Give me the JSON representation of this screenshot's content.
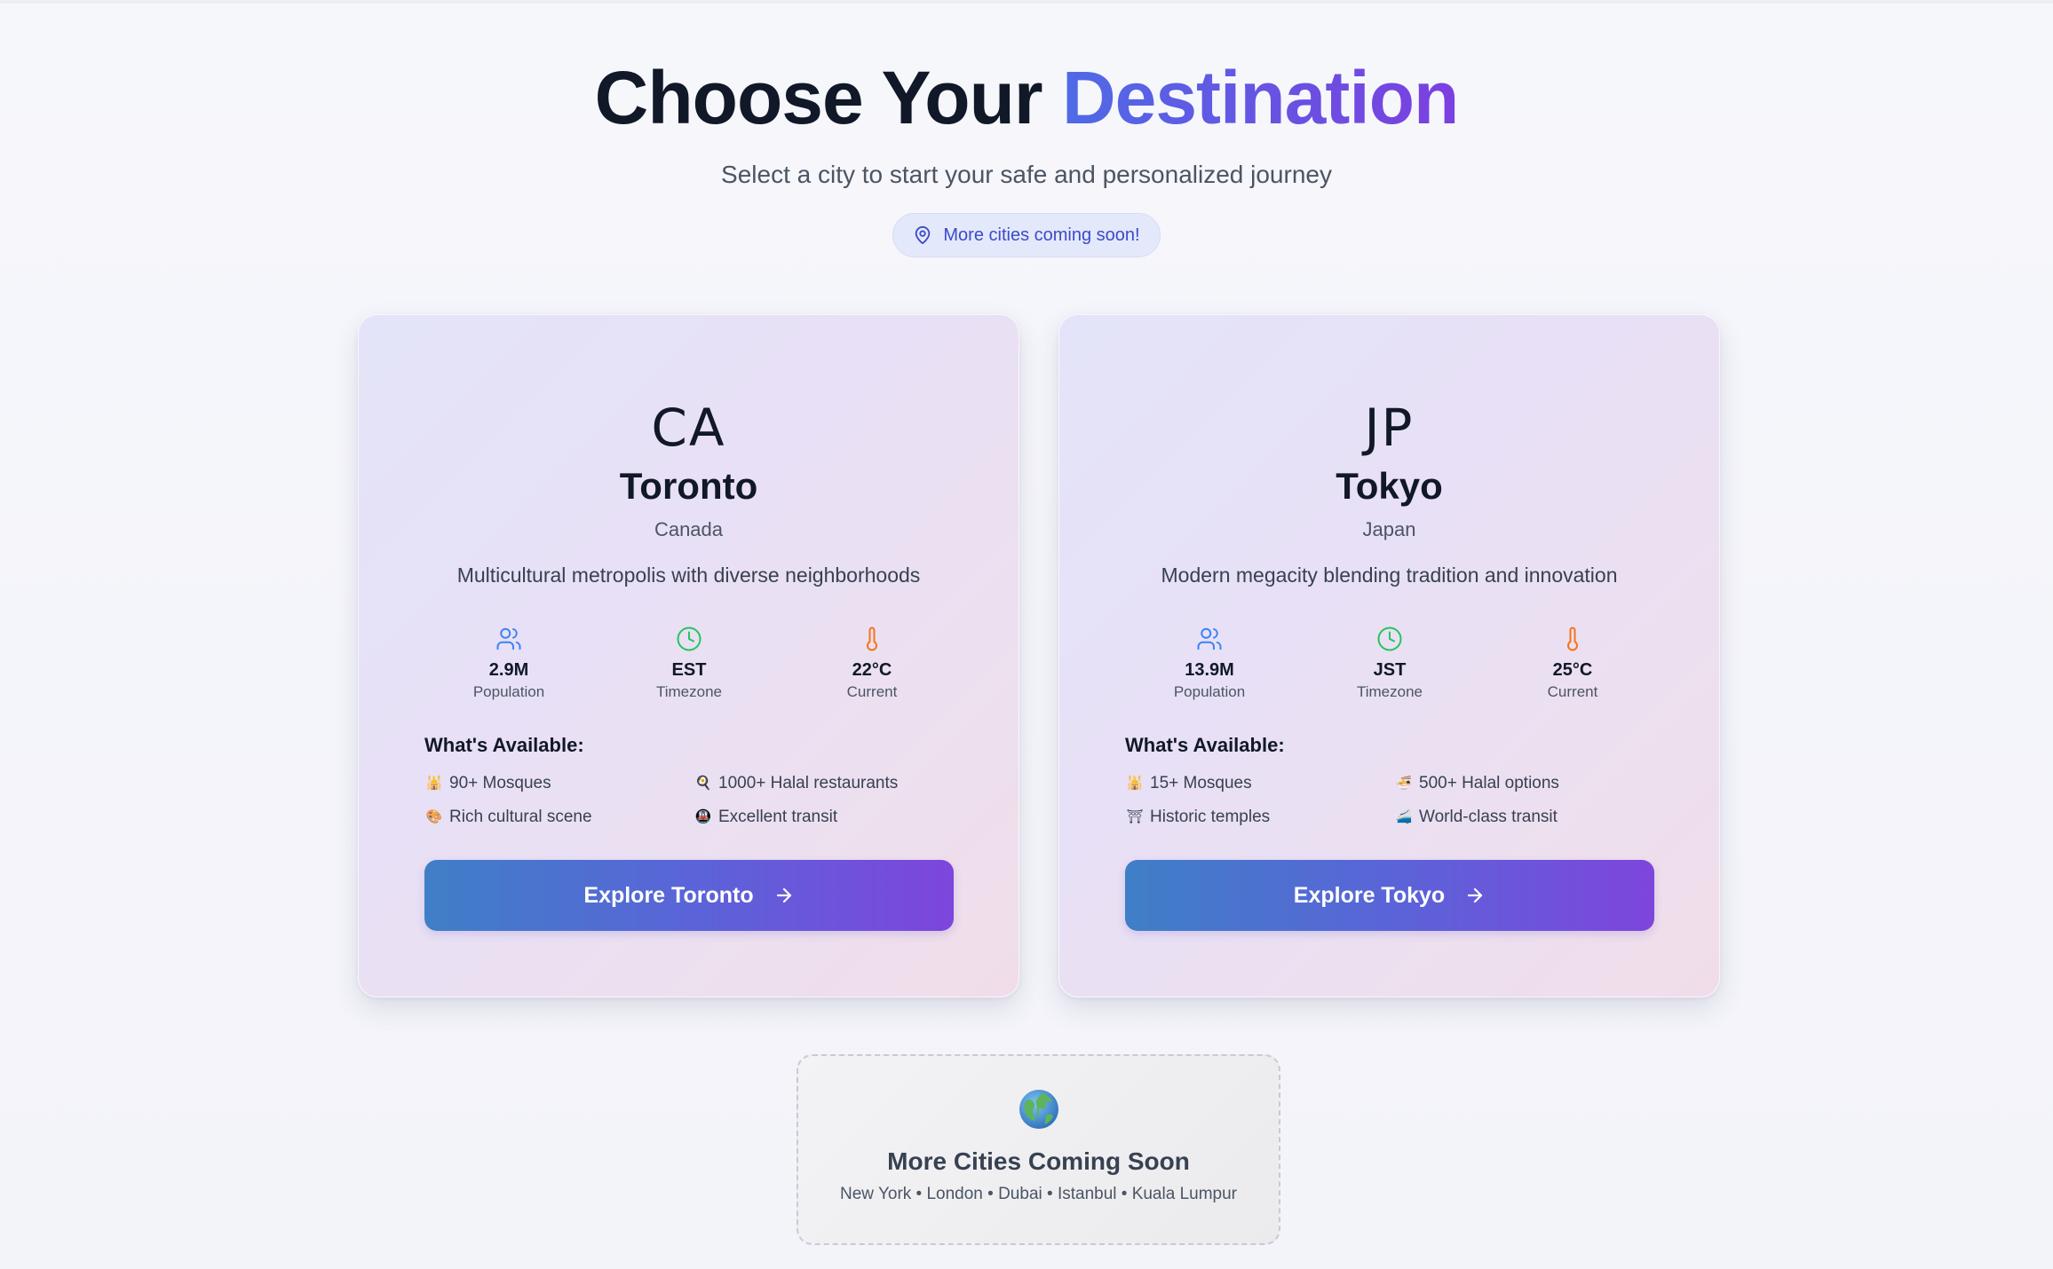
{
  "hero": {
    "title_main": "Choose Your ",
    "title_accent": "Destination",
    "subtitle": "Select a city to start your safe and personalized journey",
    "pill_label": "More cities coming soon!"
  },
  "cards": [
    {
      "country_code": "CA",
      "city": "Toronto",
      "country": "Canada",
      "description": "Multicultural metropolis with diverse neighborhoods",
      "stats": [
        {
          "icon": "users-icon",
          "value": "2.9M",
          "label": "Population",
          "color": "#3b82f6"
        },
        {
          "icon": "clock-icon",
          "value": "EST",
          "label": "Timezone",
          "color": "#22c55e"
        },
        {
          "icon": "thermometer-icon",
          "value": "22°C",
          "label": "Current",
          "color": "#f97316"
        }
      ],
      "available_title": "What's Available:",
      "available": [
        {
          "icon": "mosque-people-icon",
          "text": "90+ Mosques"
        },
        {
          "icon": "food-icon",
          "text": "1000+ Halal restaurants"
        },
        {
          "icon": "palette-icon",
          "text": "Rich cultural scene"
        },
        {
          "icon": "metro-icon",
          "text": "Excellent transit"
        }
      ],
      "button_label": "Explore Toronto"
    },
    {
      "country_code": "JP",
      "city": "Tokyo",
      "country": "Japan",
      "description": "Modern megacity blending tradition and innovation",
      "stats": [
        {
          "icon": "users-icon",
          "value": "13.9M",
          "label": "Population",
          "color": "#3b82f6"
        },
        {
          "icon": "clock-icon",
          "value": "JST",
          "label": "Timezone",
          "color": "#22c55e"
        },
        {
          "icon": "thermometer-icon",
          "value": "25°C",
          "label": "Current",
          "color": "#f97316"
        }
      ],
      "available_title": "What's Available:",
      "available": [
        {
          "icon": "mosque-people-icon",
          "text": "15+ Mosques"
        },
        {
          "icon": "ramen-icon",
          "text": "500+ Halal options"
        },
        {
          "icon": "temple-icon",
          "text": "Historic temples"
        },
        {
          "icon": "train-icon",
          "text": "World-class transit"
        }
      ],
      "button_label": "Explore Tokyo"
    }
  ],
  "more": {
    "icon": "globe-icon",
    "title": "More Cities Coming Soon",
    "cities": "New York • London • Dubai • Istanbul • Kuala Lumpur"
  },
  "colors": {
    "accent_start": "#4f6ae6",
    "accent_end": "#7c3fe0",
    "button_start": "#3f7fc7",
    "button_end": "#7e45dd"
  }
}
